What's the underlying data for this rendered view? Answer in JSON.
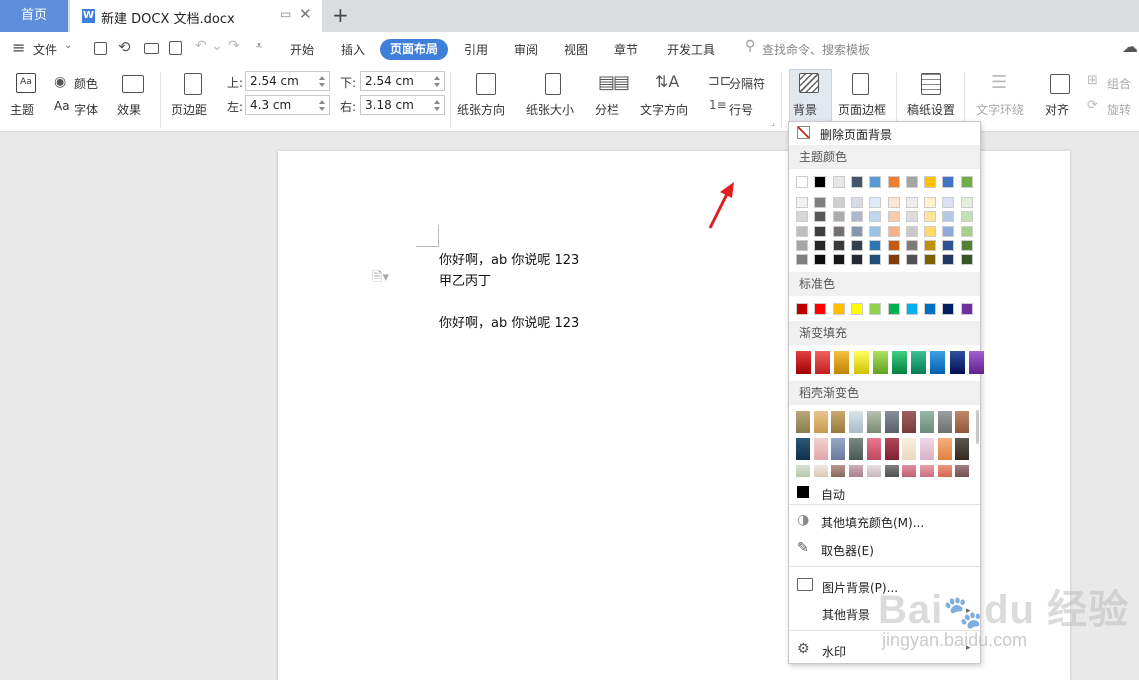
{
  "titlebar": {
    "home_tab": "首页",
    "doc_icon": "W",
    "doc_tab": "新建 DOCX 文档.docx",
    "add_tab": "+"
  },
  "menubar": {
    "file": "文件",
    "tabs": [
      "开始",
      "插入",
      "页面布局",
      "引用",
      "审阅",
      "视图",
      "章节",
      "开发工具"
    ],
    "search_placeholder": "查找命令、搜索模板"
  },
  "ribbon": {
    "theme": "主题",
    "color": "颜色",
    "font": "字体",
    "font_icon": "Aa",
    "effect": "效果",
    "margins": "页边距",
    "top_label": "上:",
    "top_value": "2.54 cm",
    "bottom_label": "下:",
    "bottom_value": "2.54 cm",
    "left_label": "左:",
    "left_value": "4.3 cm",
    "right_label": "右:",
    "right_value": "3.18 cm",
    "orientation": "纸张方向",
    "size": "纸张大小",
    "columns": "分栏",
    "text_direction": "文字方向",
    "separator": "分隔符",
    "line_number": "行号",
    "background": "背景",
    "page_border": "页面边框",
    "grid_paper": "稿纸设置",
    "text_wrap": "文字环绕",
    "align": "对齐",
    "group": "组合",
    "rotate": "旋转"
  },
  "document": {
    "lines": [
      "你好啊，ab 你说呢 123",
      "甲乙丙丁",
      "你好啊，ab 你说呢 123"
    ]
  },
  "bg_menu": {
    "remove_bg": "删除页面背景",
    "theme_colors_title": "主题颜色",
    "theme_colors_top": [
      "#ffffff",
      "#000000",
      "#e7e6e6",
      "#44546a",
      "#5b9bd5",
      "#ed7d31",
      "#a5a5a5",
      "#ffc000",
      "#4472c4",
      "#70ad47"
    ],
    "theme_colors_shades": [
      [
        "#f2f2f2",
        "#7f7f7f",
        "#d0cece",
        "#d6dce4",
        "#deebf6",
        "#fbe5d5",
        "#ededed",
        "#fff2cc",
        "#d9e2f3",
        "#e2efd9"
      ],
      [
        "#d8d8d8",
        "#595959",
        "#aeabab",
        "#adb9ca",
        "#bdd7ee",
        "#f7cbac",
        "#dbdbdb",
        "#fee599",
        "#b4c6e7",
        "#c5e0b3"
      ],
      [
        "#bfbfbf",
        "#3f3f3f",
        "#757070",
        "#8496b0",
        "#9cc3e5",
        "#f4b183",
        "#c9c9c9",
        "#ffd965",
        "#8eaadb",
        "#a8d08d"
      ],
      [
        "#a5a5a5",
        "#262626",
        "#3a3838",
        "#323f4f",
        "#2e75b5",
        "#c55a11",
        "#7b7b7b",
        "#bf9000",
        "#2f5496",
        "#538135"
      ],
      [
        "#7f7f7f",
        "#0c0c0c",
        "#171616",
        "#222a35",
        "#1e4e79",
        "#833c0b",
        "#525252",
        "#7f6000",
        "#1f3864",
        "#375623"
      ]
    ],
    "standard_title": "标准色",
    "standard_colors": [
      "#c00000",
      "#ff0000",
      "#ffc000",
      "#ffff00",
      "#92d050",
      "#00b050",
      "#00b0f0",
      "#0070c0",
      "#002060",
      "#7030a0"
    ],
    "gradient_title": "渐变填充",
    "gradient_colors": [
      [
        "#e04040",
        "#a00000"
      ],
      [
        "#f06060",
        "#c02020"
      ],
      [
        "#f5c040",
        "#c08000"
      ],
      [
        "#ffff60",
        "#d0c000"
      ],
      [
        "#b0e060",
        "#60a020"
      ],
      [
        "#40d080",
        "#008040"
      ],
      [
        "#40c090",
        "#008050"
      ],
      [
        "#40a0e0",
        "#0060b0"
      ],
      [
        "#3050a0",
        "#001050"
      ],
      [
        "#a060d0",
        "#602090"
      ]
    ],
    "daoke_title": "稻壳渐变色",
    "daoke_rows": [
      [
        [
          "#b9a77a",
          "#8b7a4a"
        ],
        [
          "#e8c48a",
          "#c99a50"
        ],
        [
          "#c8a870",
          "#9a7a3a"
        ],
        [
          "#d8e4ea",
          "#a8bcc8"
        ],
        [
          "#b8c0b0",
          "#7a8a72"
        ],
        [
          "#8a8e98",
          "#5a5e68"
        ],
        [
          "#a06060",
          "#7a3a3a"
        ],
        [
          "#9ab8a8",
          "#6a8a7a"
        ],
        [
          "#9aa0a0",
          "#6a7070"
        ],
        [
          "#c08868",
          "#905838"
        ]
      ],
      [
        [
          "#2a5878",
          "#10304a"
        ],
        [
          "#f4d0d0",
          "#e0a8a8"
        ],
        [
          "#9aa8c8",
          "#6a78a0"
        ],
        [
          "#7a8a80",
          "#4a5a50"
        ],
        [
          "#e87890",
          "#c04860"
        ],
        [
          "#b04858",
          "#802030"
        ],
        [
          "#f8f0e0",
          "#e8d8c0"
        ],
        [
          "#f0d8e8",
          "#d8b0c8"
        ],
        [
          "#f4b080",
          "#e08040"
        ],
        [
          "#605850",
          "#302820"
        ]
      ],
      [
        [
          "#d8e0d0",
          "#b8c8b0"
        ],
        [
          "#f0e8e0",
          "#d8c8b8"
        ],
        [
          "#b89890",
          "#8a6860"
        ],
        [
          "#d0b0b8",
          "#a88088"
        ],
        [
          "#e8e0e0",
          "#c8b8b8"
        ],
        [
          "#808080",
          "#505050"
        ],
        [
          "#e090a0",
          "#c06070"
        ],
        [
          "#e8a0a8",
          "#c87080"
        ],
        [
          "#f09880",
          "#d06850"
        ],
        [
          "#a08080",
          "#705050"
        ]
      ]
    ],
    "auto": "自动",
    "more_fill": "其他填充颜色(M)...",
    "picker": "取色器(E)",
    "picture_bg": "图片背景(P)...",
    "other_bg": "其他背景",
    "watermark": "水印"
  },
  "watermark_overlay": "jingyan.baidu.com"
}
